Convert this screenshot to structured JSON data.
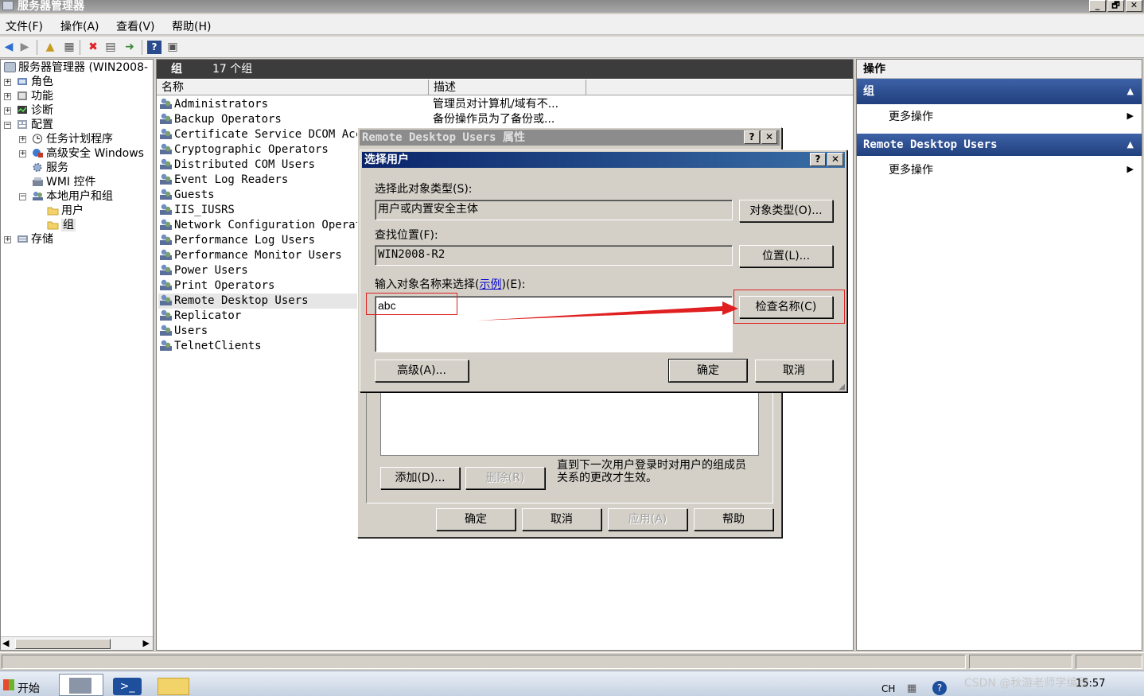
{
  "window": {
    "title": "服务器管理器"
  },
  "window_buttons": [
    "_",
    "🗗",
    "✕"
  ],
  "menu": [
    {
      "label": "文件(F)"
    },
    {
      "label": "操作(A)"
    },
    {
      "label": "查看(V)"
    },
    {
      "label": "帮助(H)"
    }
  ],
  "tree": {
    "items": [
      {
        "label": "服务器管理器 (WIN2008-",
        "expander": ""
      },
      {
        "label": "角色",
        "expander": "+"
      },
      {
        "label": "功能",
        "expander": "+"
      },
      {
        "label": "诊断",
        "expander": "+"
      },
      {
        "label": "配置",
        "expander": "−"
      },
      {
        "label": "任务计划程序",
        "expander": "+"
      },
      {
        "label": "高级安全 Windows",
        "expander": "+"
      },
      {
        "label": "服务",
        "expander": ""
      },
      {
        "label": "WMI 控件",
        "expander": ""
      },
      {
        "label": "本地用户和组",
        "expander": "−"
      },
      {
        "label": "用户",
        "expander": ""
      },
      {
        "label": "组",
        "expander": ""
      },
      {
        "label": "存储",
        "expander": "+"
      }
    ]
  },
  "center": {
    "header_title": "组",
    "header_count": "17 个组",
    "columns": [
      "名称",
      "描述"
    ],
    "groups": [
      {
        "name": "Administrators",
        "desc": "管理员对计算机/域有不..."
      },
      {
        "name": "Backup Operators",
        "desc": "备份操作员为了备份或..."
      },
      {
        "name": "Certificate Service DCOM Acce",
        "desc": ""
      },
      {
        "name": "Cryptographic Operators",
        "desc": ""
      },
      {
        "name": "Distributed COM Users",
        "desc": ""
      },
      {
        "name": "Event Log Readers",
        "desc": ""
      },
      {
        "name": "Guests",
        "desc": ""
      },
      {
        "name": "IIS_IUSRS",
        "desc": ""
      },
      {
        "name": "Network Configuration Operatc",
        "desc": ""
      },
      {
        "name": "Performance Log Users",
        "desc": ""
      },
      {
        "name": "Performance Monitor Users",
        "desc": ""
      },
      {
        "name": "Power Users",
        "desc": ""
      },
      {
        "name": "Print Operators",
        "desc": ""
      },
      {
        "name": "Remote Desktop Users",
        "desc": ""
      },
      {
        "name": "Replicator",
        "desc": ""
      },
      {
        "name": "Users",
        "desc": ""
      },
      {
        "name": "TelnetClients",
        "desc": ""
      }
    ]
  },
  "actions": {
    "header": "操作",
    "sections": [
      {
        "title": "组",
        "item": "更多操作"
      },
      {
        "title": "Remote Desktop Users",
        "item": "更多操作"
      }
    ]
  },
  "props_dialog": {
    "title": "Remote Desktop Users 属性",
    "help_btn": "?",
    "close_btn": "✕",
    "add_button": "添加(D)...",
    "remove_button": "删除(R)",
    "note": "直到下一次用户登录时对用户的组成员关系的更改才生效。",
    "ok": "确定",
    "cancel": "取消",
    "apply": "应用(A)",
    "help": "帮助"
  },
  "select_dialog": {
    "title": "选择用户",
    "help_btn": "?",
    "close_btn": "✕",
    "object_type_label": "选择此对象类型(S):",
    "object_type_value": "用户或内置安全主体",
    "object_type_button": "对象类型(O)...",
    "location_label": "查找位置(F):",
    "location_value": "WIN2008-R2",
    "location_button": "位置(L)...",
    "names_label_prefix": "输入对象名称来选择(",
    "names_label_link": "示例",
    "names_label_suffix": ")(E):",
    "names_value": "abc",
    "check_names_button": "检查名称(C)",
    "advanced_button": "高级(A)...",
    "ok": "确定",
    "cancel": "取消"
  },
  "taskbar": {
    "start": "开始",
    "lang": "CH",
    "clock": "15:57",
    "watermark": "CSDN @秋游老师学编程"
  },
  "colors": {
    "dialog_title_active": "#0a246a",
    "dialog_title_inactive": "#808080",
    "action_header": "#2a4b8d",
    "highlight_red": "#e02020",
    "selection": "#e6e6e6"
  }
}
